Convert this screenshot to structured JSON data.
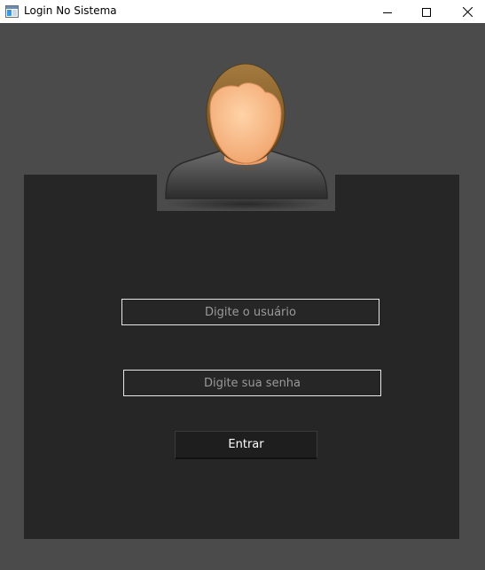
{
  "window": {
    "title": "Login No Sistema",
    "app_icon": "window-icon",
    "controls": {
      "minimize_icon": "minimize-icon",
      "maximize_icon": "maximize-icon",
      "close_icon": "close-icon"
    }
  },
  "login": {
    "avatar_icon": "user-avatar-icon",
    "username_placeholder": "Digite o usuário",
    "password_placeholder": "Digite sua senha",
    "submit_label": "Entrar"
  },
  "colors": {
    "background": "#4b4b4b",
    "panel": "#262626",
    "field_border": "#e8e8e8",
    "placeholder_text": "#9a9a9a",
    "button_text": "#ffffff"
  }
}
